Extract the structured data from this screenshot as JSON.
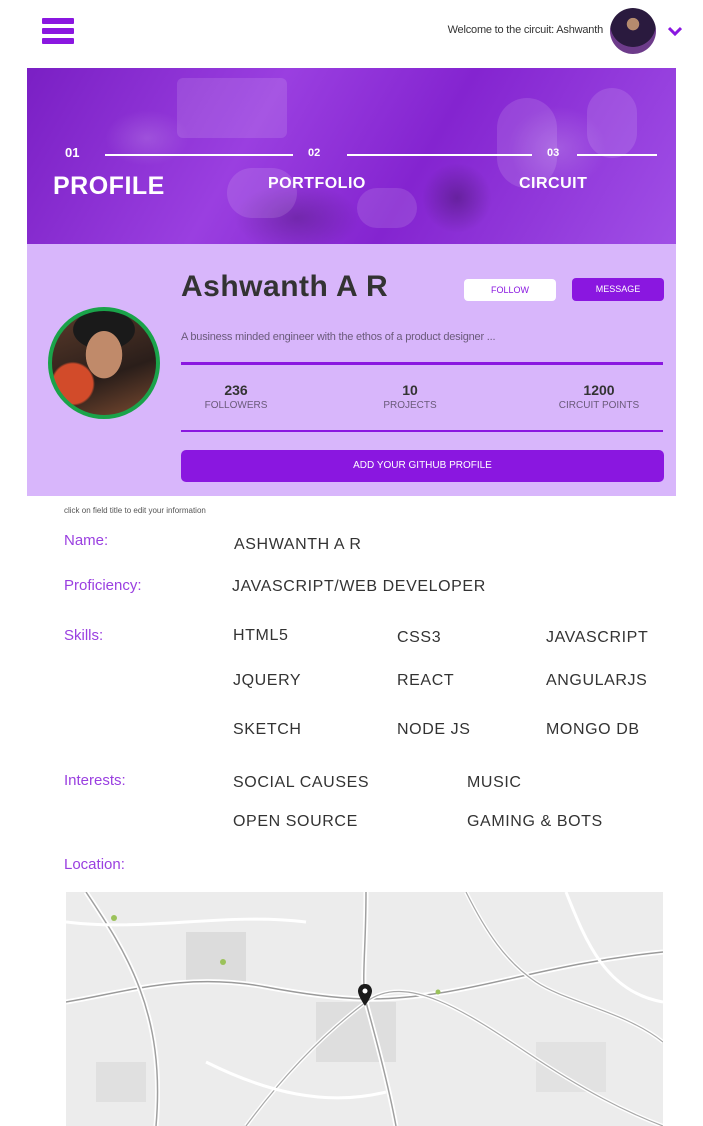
{
  "topbar": {
    "welcome_text": "Welcome to the circuit: Ashwanth"
  },
  "steps": [
    {
      "number": "01",
      "label": "PROFILE"
    },
    {
      "number": "02",
      "label": "PORTFOLIO"
    },
    {
      "number": "03",
      "label": "CIRCUIT"
    }
  ],
  "profile": {
    "name": "Ashwanth A R",
    "follow_label": "FOLLOW",
    "message_label": "MESSAGE",
    "bio": "A business minded engineer with the ethos of a product designer ...",
    "stats": [
      {
        "value": "236",
        "label": "FOLLOWERS"
      },
      {
        "value": "10",
        "label": "PROJECTS"
      },
      {
        "value": "1200",
        "label": "CIRCUIT POINTS"
      }
    ],
    "github_label": "ADD YOUR GITHUB PROFILE"
  },
  "info": {
    "hint": "click on field title to edit your information",
    "name_label": "Name:",
    "name_value": "ASHWANTH A R",
    "proficiency_label": "Proficiency:",
    "proficiency_value": "JAVASCRIPT/WEB DEVELOPER",
    "skills_label": "Skills:",
    "skills": [
      "HTML5",
      "CSS3",
      "JAVASCRIPT",
      "JQUERY",
      "REACT",
      "ANGULARJS",
      "SKETCH",
      "NODE JS",
      "MONGO DB"
    ],
    "interests_label": "Interests:",
    "interests": [
      "SOCIAL CAUSES",
      "MUSIC",
      "OPEN SOURCE",
      "GAMING & BOTS"
    ],
    "location_label": "Location:"
  },
  "colors": {
    "accent": "#8a17e0",
    "card_bg": "#d8b6fb",
    "label": "#9a3fe0",
    "avatar_ring": "#1aa34a"
  }
}
